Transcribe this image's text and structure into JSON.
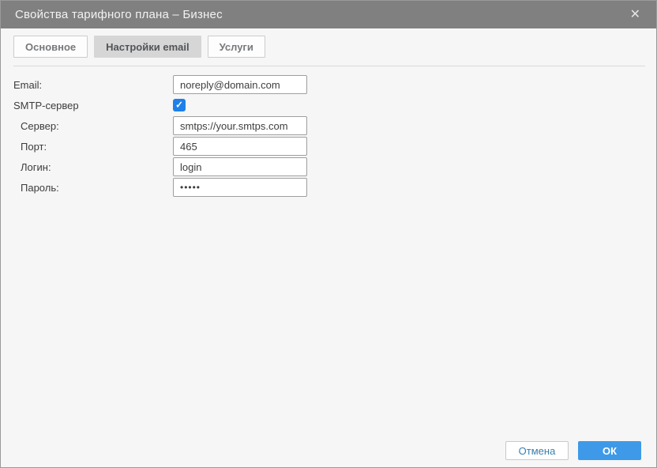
{
  "window": {
    "title": "Свойства тарифного плана – Бизнес",
    "close_glyph": "✕"
  },
  "tabs": [
    {
      "label": "Основное",
      "active": false
    },
    {
      "label": "Настройки email",
      "active": true
    },
    {
      "label": "Услуги",
      "active": false
    }
  ],
  "form": {
    "email": {
      "label": "Email:",
      "value": "noreply@domain.com"
    },
    "smtp": {
      "label": "SMTP-сервер",
      "checked": true,
      "check_glyph": "✓"
    },
    "server": {
      "label": "Сервер:",
      "value": "smtps://your.smtps.com"
    },
    "port": {
      "label": "Порт:",
      "value": "465"
    },
    "login": {
      "label": "Логин:",
      "value": "login"
    },
    "password": {
      "label": "Пароль:",
      "value": "•••••"
    }
  },
  "footer": {
    "cancel_label": "Отмена",
    "ok_label": "ОК"
  },
  "colors": {
    "titlebar_bg": "#808080",
    "accent_blue": "#3e9ae8",
    "checkbox_blue": "#1e80e8",
    "active_tab_bg": "#d6d6d6"
  }
}
